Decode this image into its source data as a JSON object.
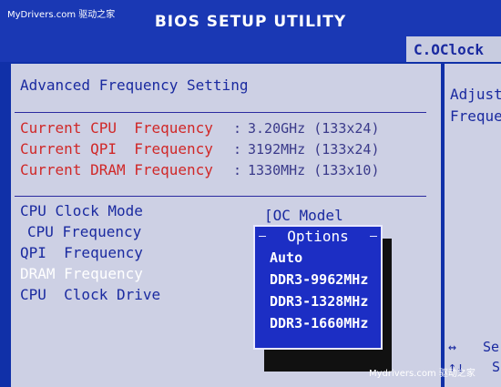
{
  "watermark_top": "MyDrivers.com 驱动之家",
  "header": {
    "title": "BIOS SETUP UTILITY",
    "active_tab": "C.OClock"
  },
  "main": {
    "section_title": "Advanced Frequency Setting",
    "current": [
      {
        "label": "Current CPU  Frequency",
        "sep": ":",
        "value": "3.20GHz (133x24)"
      },
      {
        "label": "Current QPI  Frequency",
        "sep": ":",
        "value": "3192MHz (133x24)"
      },
      {
        "label": "Current DRAM Frequency",
        "sep": ":",
        "value": "1330MHz (133x10)"
      }
    ],
    "settings": [
      {
        "label": "CPU Clock Mode"
      },
      {
        "label": "CPU Frequency"
      },
      {
        "label": "QPI  Frequency"
      },
      {
        "label": "DRAM Frequency"
      },
      {
        "label": "CPU  Clock Drive"
      }
    ],
    "oc_mode_value": "[OC Model"
  },
  "popup": {
    "title": "Options",
    "options": [
      "Auto",
      "DDR3-9962MHz",
      "DDR3-1328MHz",
      "DDR3-1660MHz"
    ]
  },
  "side": {
    "help": [
      "Adjust",
      "Freque"
    ],
    "keys": [
      "↔",
      "↑↓"
    ],
    "key_text": [
      "Se",
      "S"
    ]
  },
  "watermark_bottom": "Mydrivers.com 驱动之家",
  "colors": {
    "background": "#1030a8",
    "panel": "#cdd0e4",
    "red_text": "#d02828",
    "blue_text": "#1a2aa0",
    "popup": "#1c2ec4"
  }
}
